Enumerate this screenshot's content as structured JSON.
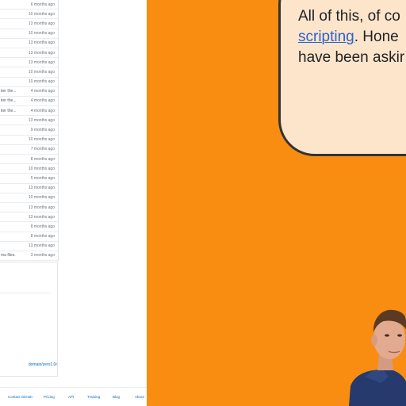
{
  "file_list": {
    "rows": [
      {
        "message": "",
        "age": "6 months ago"
      },
      {
        "message": "",
        "age": "10 months ago"
      },
      {
        "message": "",
        "age": "13 months ago"
      },
      {
        "message": "",
        "age": "10 months ago"
      },
      {
        "message": "",
        "age": "13 months ago"
      },
      {
        "message": "",
        "age": "13 months ago"
      },
      {
        "message": "",
        "age": "13 months ago"
      },
      {
        "message": "",
        "age": "10 months ago"
      },
      {
        "message": "",
        "age": "10 months ago"
      },
      {
        "message": "iter the...",
        "age": "4 months ago"
      },
      {
        "message": "iter the...",
        "age": "4 months ago"
      },
      {
        "message": "iter the...",
        "age": "4 months ago"
      },
      {
        "message": "",
        "age": "13 months ago"
      },
      {
        "message": "",
        "age": "9 months ago"
      },
      {
        "message": "",
        "age": "10 months ago"
      },
      {
        "message": "",
        "age": "7 months ago"
      },
      {
        "message": "",
        "age": "8 months ago"
      },
      {
        "message": "",
        "age": "10 months ago"
      },
      {
        "message": "",
        "age": "5 months ago"
      },
      {
        "message": "",
        "age": "13 months ago"
      },
      {
        "message": "",
        "age": "10 months ago"
      },
      {
        "message": "",
        "age": "13 months ago"
      },
      {
        "message": "",
        "age": "13 months ago"
      },
      {
        "message": "",
        "age": "8 months ago"
      },
      {
        "message": "",
        "age": "8 months ago"
      },
      {
        "message": "",
        "age": "13 months ago"
      },
      {
        "message": "ma files.",
        "age": "3 months ago"
      }
    ]
  },
  "readme": {
    "link_text": "domain/zero1.0r"
  },
  "footer": {
    "links": [
      "Contact GitHub",
      "Pricing",
      "API",
      "Training",
      "Blog",
      "About"
    ]
  },
  "slide": {
    "line1": "All of this, of co",
    "line2_link": "scripting",
    "line2_rest": ". Hone",
    "line3": "have been askir"
  },
  "colors": {
    "slide_background": "#f98d12",
    "bubble_fill": "#fde5cc",
    "bubble_border": "#333333",
    "link": "#2a62c9",
    "github_link": "#0366d6"
  }
}
